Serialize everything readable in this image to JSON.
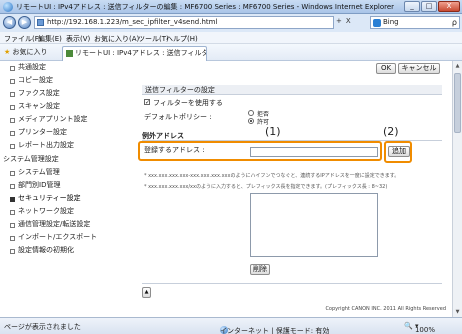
{
  "window": {
    "title": "リモートUI : IPv4アドレス : 送信フィルターの編集 : MF6700 Series : MF6700 Series - Windows Internet Explorer",
    "minimize": "_",
    "maximize": "□",
    "close": "X"
  },
  "address": {
    "url": "http://192.168.1.223/m_sec_ipfilter_v4send.html",
    "refresh": "+",
    "stop": "X",
    "search_engine": "Bing",
    "search_button": "ρ"
  },
  "menu": [
    "ファイル(F)",
    "編集(E)",
    "表示(V)",
    "お気に入り(A)",
    "ツール(T)",
    "ヘルプ(H)"
  ],
  "favorites": {
    "button": "お気に入り",
    "tab": "リモートUI : IPv4アドレス : 送信フィルター..."
  },
  "sidebar": {
    "items": [
      "共通設定",
      "コピー設定",
      "ファクス設定",
      "スキャン設定",
      "メディアプリント設定",
      "プリンター設定",
      "レポート出力設定"
    ],
    "group": "システム管理設定",
    "sub_items": [
      "システム管理",
      "部門別ID管理",
      "セキュリティー設定",
      "ネットワーク設定",
      "通信管理設定/転送設定",
      "インポート/エクスポート",
      "設定情報の初期化"
    ]
  },
  "content": {
    "ok": "OK",
    "cancel": "キャンセル",
    "section_send_filter": "送信フィルターの設定",
    "use_filter_label": "フィルターを使用する",
    "use_filter_checked": true,
    "default_policy_label": "デフォルトポリシー :",
    "policy_reject": "拒否",
    "policy_allow": "許可",
    "policy_selected": "許可",
    "exceptions_heading": "例外アドレス",
    "address_to_register": "登録するアドレス :",
    "address_value": "",
    "add_button": "追加",
    "note1": "* xxx.xxx.xxx.xxx-xxx.xxx.xxx.xxxのようにハイフンでつなぐと、連続するIPアドレスを一度に設定できます。",
    "note2": "* xxx.xxx.xxx.xxx/xxのように入力すると、プレフィックス長を指定できます。(プレフィックス長 : 8~32)",
    "delete_button": "削除",
    "top_link": "▲",
    "copyright": "Copyright CANON INC. 2011 All Rights Reserved"
  },
  "callouts": {
    "label1": "(1)",
    "label2": "(2)",
    "color": "#f08c00"
  },
  "status": {
    "left": "ページが表示されました",
    "zone": "インターネット | 保護モード: 有効",
    "zoom": "100%"
  }
}
